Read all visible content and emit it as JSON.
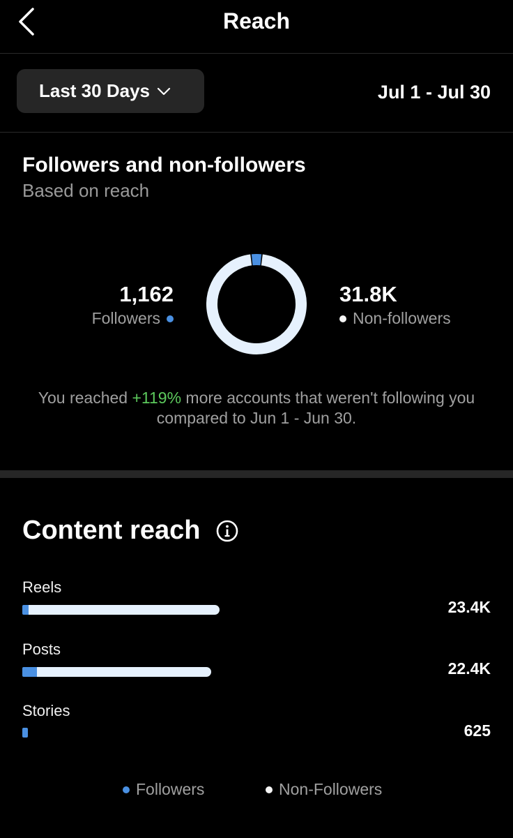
{
  "header": {
    "title": "Reach"
  },
  "filter": {
    "range_label": "Last 30 Days",
    "date_range": "Jul 1 - Jul 30"
  },
  "audience": {
    "title": "Followers and non-followers",
    "subtitle": "Based on reach",
    "followers_value": "1,162",
    "followers_label": "Followers",
    "non_followers_value": "31.8K",
    "non_followers_label": "Non-followers",
    "note_prefix": "You reached ",
    "note_percent": "+119%",
    "note_suffix": " more accounts that weren't following you compared to Jun 1 - Jun 30."
  },
  "chart_data": {
    "type": "pie",
    "title": "Followers and non-followers",
    "categories": [
      "Followers",
      "Non-followers"
    ],
    "values": [
      1162,
      31800
    ],
    "colors": [
      "#4a90e2",
      "#e6f1fd"
    ]
  },
  "content_reach": {
    "title": "Content reach",
    "rows": [
      {
        "label": "Reels",
        "value": "23.4K",
        "follower_fraction": 0.032,
        "total_fraction": 1.0
      },
      {
        "label": "Posts",
        "value": "22.4K",
        "follower_fraction": 0.076,
        "total_fraction": 0.958
      },
      {
        "label": "Stories",
        "value": "625",
        "follower_fraction": 1.0,
        "total_fraction": 0.027
      }
    ],
    "legend": {
      "followers": "Followers",
      "non_followers": "Non-Followers"
    }
  },
  "colors": {
    "background": "#000000",
    "followers": "#4a90e2",
    "non_followers": "#e6f1fd",
    "positive": "#5cc95c",
    "muted_text": "#a0a0a0"
  }
}
